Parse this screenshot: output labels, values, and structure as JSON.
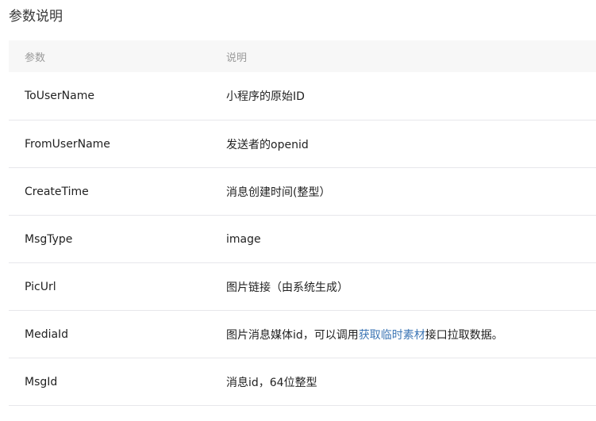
{
  "section": {
    "title": "参数说明"
  },
  "table": {
    "headers": {
      "param": "参数",
      "description": "说明"
    },
    "rows": [
      {
        "param": "ToUserName",
        "description": "小程序的原始ID"
      },
      {
        "param": "FromUserName",
        "description": "发送者的openid"
      },
      {
        "param": "CreateTime",
        "description": "消息创建时间(整型）"
      },
      {
        "param": "MsgType",
        "description": "image"
      },
      {
        "param": "PicUrl",
        "description": "图片链接（由系统生成）"
      },
      {
        "param": "MediaId",
        "description_before": "图片消息媒体id，可以调用",
        "description_link": "获取临时素材",
        "description_after": "接口拉取数据。"
      },
      {
        "param": "MsgId",
        "description": "消息id，64位整型"
      }
    ]
  },
  "colors": {
    "link": "#3d76b5",
    "header_bg": "#f7f7f7",
    "divider": "#e7e7eb"
  }
}
